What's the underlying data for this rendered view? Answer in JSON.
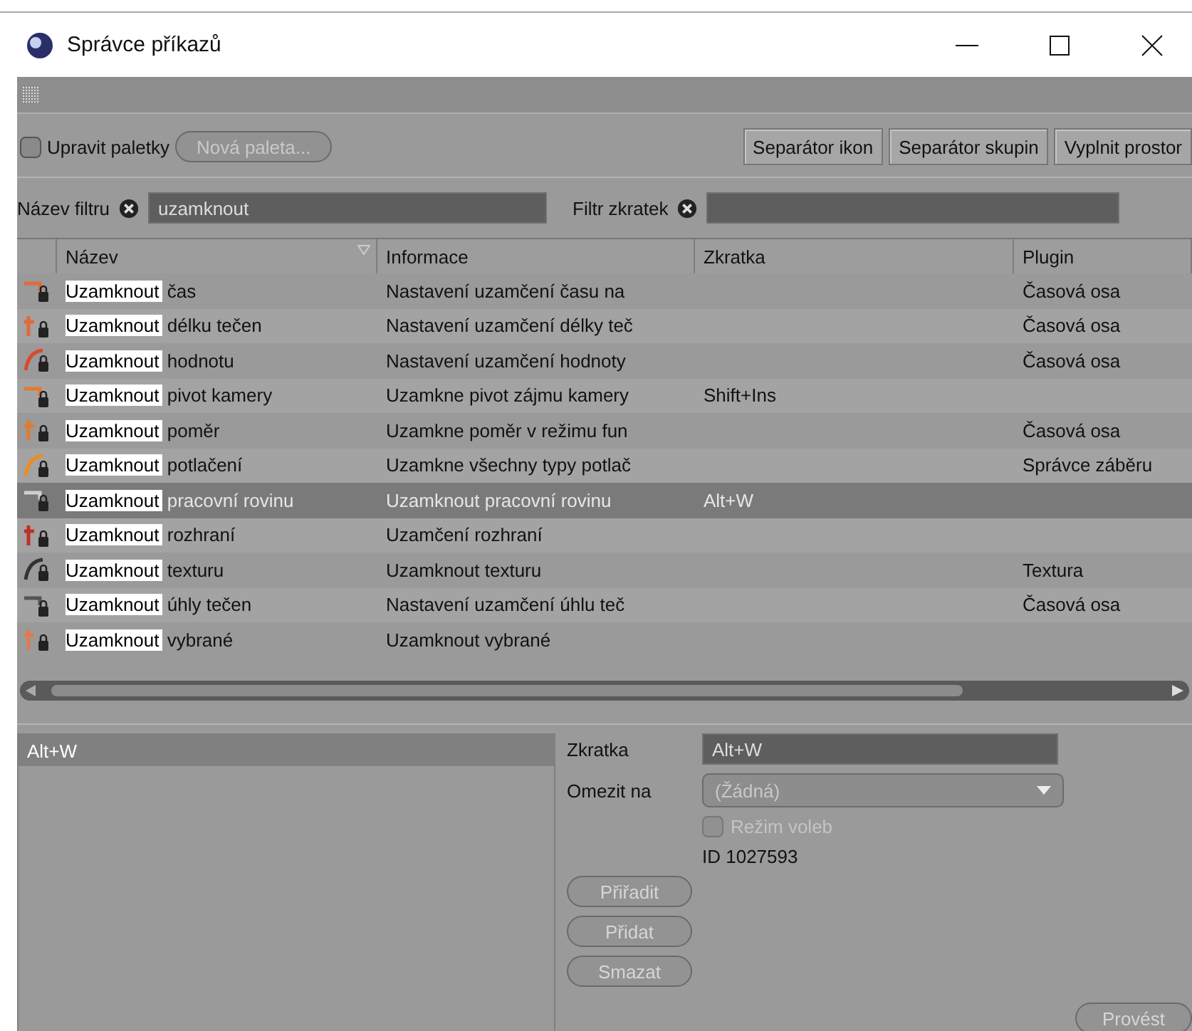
{
  "window": {
    "title": "Správce příkazů"
  },
  "toolbar": {
    "edit_palettes": {
      "label": "Upravit paletky",
      "checked": false
    },
    "new_palette": {
      "label": "Nová paleta...",
      "disabled": true
    },
    "buttons": [
      "Separátor ikon",
      "Separátor skupin",
      "Vyplnit prostor"
    ]
  },
  "filters": {
    "name_label": "Název filtru",
    "name_value": "uzamknout",
    "shortcut_label": "Filtr zkratek"
  },
  "table": {
    "columns": [
      "Název",
      "Informace",
      "Zkratka",
      "Plugin"
    ],
    "rows": [
      {
        "name_match": "Uzamknout",
        "name_rest": "čas",
        "info": "Nastavení uzamčení času na",
        "shortcut": "",
        "plugin": "Časová osa",
        "selected": false
      },
      {
        "name_match": "Uzamknout",
        "name_rest": "délku tečen",
        "info": "Nastavení uzamčení délky teč",
        "shortcut": "",
        "plugin": "Časová osa",
        "selected": false
      },
      {
        "name_match": "Uzamknout",
        "name_rest": "hodnotu",
        "info": "Nastavení uzamčení hodnoty",
        "shortcut": "",
        "plugin": "Časová osa",
        "selected": false
      },
      {
        "name_match": "Uzamknout",
        "name_rest": "pivot kamery",
        "info": "Uzamkne pivot zájmu kamery",
        "shortcut": "Shift+Ins",
        "plugin": "",
        "selected": false
      },
      {
        "name_match": "Uzamknout",
        "name_rest": "poměr",
        "info": "Uzamkne poměr v režimu fun",
        "shortcut": "",
        "plugin": "Časová osa",
        "selected": false
      },
      {
        "name_match": "Uzamknout",
        "name_rest": "potlačení",
        "info": "Uzamkne všechny typy potlač",
        "shortcut": "",
        "plugin": "Správce záběru",
        "selected": false
      },
      {
        "name_match": "Uzamknout",
        "name_rest": "pracovní rovinu",
        "info": "Uzamknout pracovní rovinu",
        "shortcut": "Alt+W",
        "plugin": "",
        "selected": true
      },
      {
        "name_match": "Uzamknout",
        "name_rest": "rozhraní",
        "info": "Uzamčení rozhraní",
        "shortcut": "",
        "plugin": "",
        "selected": false
      },
      {
        "name_match": "Uzamknout",
        "name_rest": "texturu",
        "info": "Uzamknout texturu",
        "shortcut": "",
        "plugin": "Textura",
        "selected": false
      },
      {
        "name_match": "Uzamknout",
        "name_rest": "úhly tečen",
        "info": "Nastavení uzamčení úhlu teč",
        "shortcut": "",
        "plugin": "Časová osa",
        "selected": false
      },
      {
        "name_match": "Uzamknout",
        "name_rest": "vybrané",
        "info": "Uzamknout vybrané",
        "shortcut": "",
        "plugin": "",
        "selected": false
      }
    ]
  },
  "shortcuts_list": [
    {
      "label": "Alt+W",
      "selected": true
    }
  ],
  "details": {
    "shortcut_label": "Zkratka",
    "shortcut_value": "Alt+W",
    "restrict_label": "Omezit na",
    "restrict_value": "(Žádná)",
    "mode": {
      "label": "Režim voleb",
      "checked": false,
      "disabled": true
    },
    "id": "ID 1027593"
  },
  "actions": [
    {
      "label": "Přiřadit",
      "disabled": true
    },
    {
      "label": "Přidat",
      "disabled": true
    },
    {
      "label": "Smazat",
      "disabled": true
    }
  ],
  "execute": {
    "label": "Provést",
    "disabled": true
  }
}
